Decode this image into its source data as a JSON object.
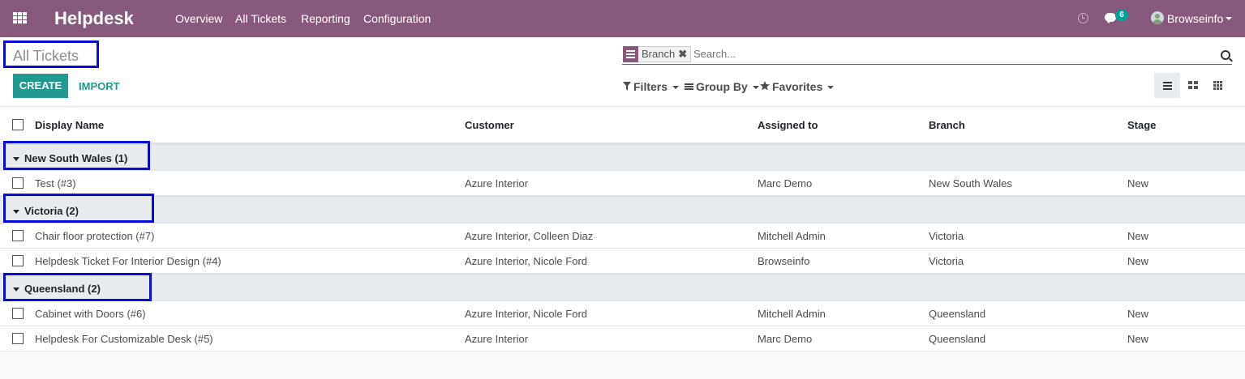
{
  "navbar": {
    "brand": "Helpdesk",
    "menu": [
      "Overview",
      "All Tickets",
      "Reporting",
      "Configuration"
    ],
    "message_count": "6",
    "user": "Browseinfo"
  },
  "control": {
    "title": "All Tickets",
    "create_label": "CREATE",
    "import_label": "IMPORT",
    "facet_label": "Branch",
    "facet_remove": "✖",
    "search_placeholder": "Search...",
    "filters_label": "Filters",
    "group_by_label": "Group By",
    "favorites_label": "Favorites"
  },
  "columns": [
    "Display Name",
    "Customer",
    "Assigned to",
    "Branch",
    "Stage"
  ],
  "groups": [
    {
      "label": "New South Wales (1)",
      "rows": [
        [
          "Test (#3)",
          "Azure Interior",
          "Marc Demo",
          "New South Wales",
          "New"
        ]
      ]
    },
    {
      "label": "Victoria (2)",
      "rows": [
        [
          "Chair floor protection (#7)",
          "Azure Interior, Colleen Diaz",
          "Mitchell Admin",
          "Victoria",
          "New"
        ],
        [
          "Helpdesk Ticket For Interior Design (#4)",
          "Azure Interior, Nicole Ford",
          "Browseinfo",
          "Victoria",
          "New"
        ]
      ]
    },
    {
      "label": "Queensland (2)",
      "rows": [
        [
          "Cabinet with Doors (#6)",
          "Azure Interior, Nicole Ford",
          "Mitchell Admin",
          "Queensland",
          "New"
        ],
        [
          "Helpdesk For Customizable Desk (#5)",
          "Azure Interior",
          "Marc Demo",
          "Queensland",
          "New"
        ]
      ]
    }
  ],
  "colors": {
    "navbar": "#875a7b",
    "primary_button": "#21998f",
    "highlight_box": "#0b0bd6",
    "group_row": "#e9ecef"
  }
}
